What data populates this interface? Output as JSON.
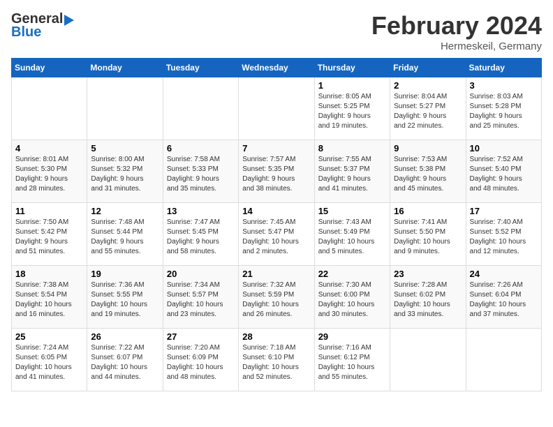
{
  "header": {
    "logo_general": "General",
    "logo_blue": "Blue",
    "title": "February 2024",
    "subtitle": "Hermeskeil, Germany"
  },
  "calendar": {
    "days_of_week": [
      "Sunday",
      "Monday",
      "Tuesday",
      "Wednesday",
      "Thursday",
      "Friday",
      "Saturday"
    ],
    "weeks": [
      [
        {
          "day": "",
          "info": ""
        },
        {
          "day": "",
          "info": ""
        },
        {
          "day": "",
          "info": ""
        },
        {
          "day": "",
          "info": ""
        },
        {
          "day": "1",
          "info": "Sunrise: 8:05 AM\nSunset: 5:25 PM\nDaylight: 9 hours\nand 19 minutes."
        },
        {
          "day": "2",
          "info": "Sunrise: 8:04 AM\nSunset: 5:27 PM\nDaylight: 9 hours\nand 22 minutes."
        },
        {
          "day": "3",
          "info": "Sunrise: 8:03 AM\nSunset: 5:28 PM\nDaylight: 9 hours\nand 25 minutes."
        }
      ],
      [
        {
          "day": "4",
          "info": "Sunrise: 8:01 AM\nSunset: 5:30 PM\nDaylight: 9 hours\nand 28 minutes."
        },
        {
          "day": "5",
          "info": "Sunrise: 8:00 AM\nSunset: 5:32 PM\nDaylight: 9 hours\nand 31 minutes."
        },
        {
          "day": "6",
          "info": "Sunrise: 7:58 AM\nSunset: 5:33 PM\nDaylight: 9 hours\nand 35 minutes."
        },
        {
          "day": "7",
          "info": "Sunrise: 7:57 AM\nSunset: 5:35 PM\nDaylight: 9 hours\nand 38 minutes."
        },
        {
          "day": "8",
          "info": "Sunrise: 7:55 AM\nSunset: 5:37 PM\nDaylight: 9 hours\nand 41 minutes."
        },
        {
          "day": "9",
          "info": "Sunrise: 7:53 AM\nSunset: 5:38 PM\nDaylight: 9 hours\nand 45 minutes."
        },
        {
          "day": "10",
          "info": "Sunrise: 7:52 AM\nSunset: 5:40 PM\nDaylight: 9 hours\nand 48 minutes."
        }
      ],
      [
        {
          "day": "11",
          "info": "Sunrise: 7:50 AM\nSunset: 5:42 PM\nDaylight: 9 hours\nand 51 minutes."
        },
        {
          "day": "12",
          "info": "Sunrise: 7:48 AM\nSunset: 5:44 PM\nDaylight: 9 hours\nand 55 minutes."
        },
        {
          "day": "13",
          "info": "Sunrise: 7:47 AM\nSunset: 5:45 PM\nDaylight: 9 hours\nand 58 minutes."
        },
        {
          "day": "14",
          "info": "Sunrise: 7:45 AM\nSunset: 5:47 PM\nDaylight: 10 hours\nand 2 minutes."
        },
        {
          "day": "15",
          "info": "Sunrise: 7:43 AM\nSunset: 5:49 PM\nDaylight: 10 hours\nand 5 minutes."
        },
        {
          "day": "16",
          "info": "Sunrise: 7:41 AM\nSunset: 5:50 PM\nDaylight: 10 hours\nand 9 minutes."
        },
        {
          "day": "17",
          "info": "Sunrise: 7:40 AM\nSunset: 5:52 PM\nDaylight: 10 hours\nand 12 minutes."
        }
      ],
      [
        {
          "day": "18",
          "info": "Sunrise: 7:38 AM\nSunset: 5:54 PM\nDaylight: 10 hours\nand 16 minutes."
        },
        {
          "day": "19",
          "info": "Sunrise: 7:36 AM\nSunset: 5:55 PM\nDaylight: 10 hours\nand 19 minutes."
        },
        {
          "day": "20",
          "info": "Sunrise: 7:34 AM\nSunset: 5:57 PM\nDaylight: 10 hours\nand 23 minutes."
        },
        {
          "day": "21",
          "info": "Sunrise: 7:32 AM\nSunset: 5:59 PM\nDaylight: 10 hours\nand 26 minutes."
        },
        {
          "day": "22",
          "info": "Sunrise: 7:30 AM\nSunset: 6:00 PM\nDaylight: 10 hours\nand 30 minutes."
        },
        {
          "day": "23",
          "info": "Sunrise: 7:28 AM\nSunset: 6:02 PM\nDaylight: 10 hours\nand 33 minutes."
        },
        {
          "day": "24",
          "info": "Sunrise: 7:26 AM\nSunset: 6:04 PM\nDaylight: 10 hours\nand 37 minutes."
        }
      ],
      [
        {
          "day": "25",
          "info": "Sunrise: 7:24 AM\nSunset: 6:05 PM\nDaylight: 10 hours\nand 41 minutes."
        },
        {
          "day": "26",
          "info": "Sunrise: 7:22 AM\nSunset: 6:07 PM\nDaylight: 10 hours\nand 44 minutes."
        },
        {
          "day": "27",
          "info": "Sunrise: 7:20 AM\nSunset: 6:09 PM\nDaylight: 10 hours\nand 48 minutes."
        },
        {
          "day": "28",
          "info": "Sunrise: 7:18 AM\nSunset: 6:10 PM\nDaylight: 10 hours\nand 52 minutes."
        },
        {
          "day": "29",
          "info": "Sunrise: 7:16 AM\nSunset: 6:12 PM\nDaylight: 10 hours\nand 55 minutes."
        },
        {
          "day": "",
          "info": ""
        },
        {
          "day": "",
          "info": ""
        }
      ]
    ]
  }
}
